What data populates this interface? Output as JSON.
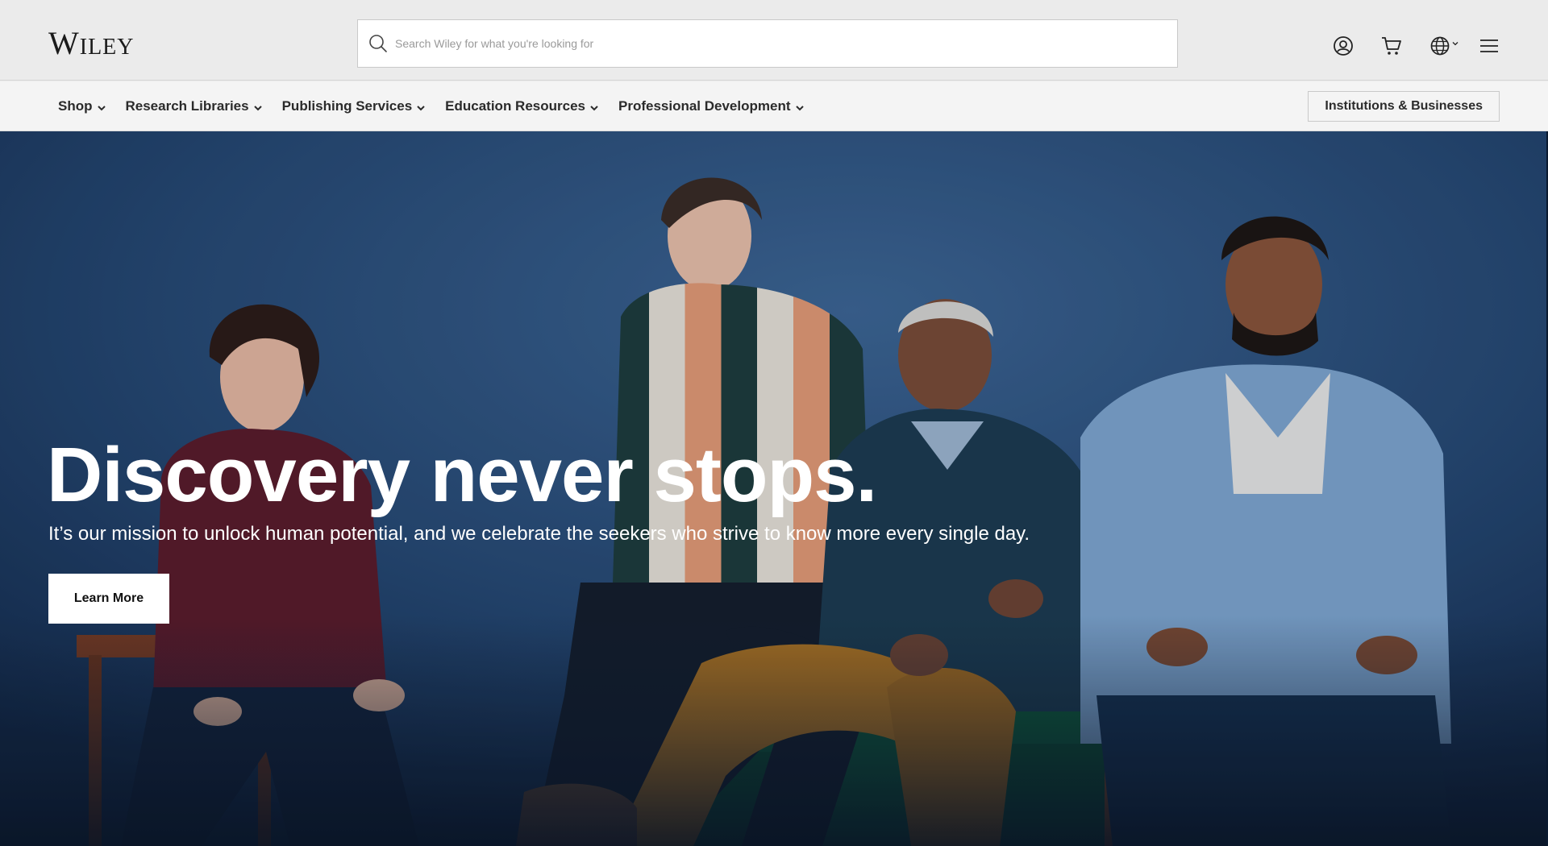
{
  "header": {
    "logo_text": "Wiley",
    "search": {
      "placeholder": "Search Wiley for what you're looking for",
      "value": ""
    },
    "icons": [
      "account-icon",
      "cart-icon",
      "globe-icon",
      "menu-icon"
    ]
  },
  "nav": {
    "items": [
      {
        "label": "Shop"
      },
      {
        "label": "Research Libraries"
      },
      {
        "label": "Publishing Services"
      },
      {
        "label": "Education Resources"
      },
      {
        "label": "Professional Development"
      }
    ],
    "cta_label": "Institutions & Businesses"
  },
  "hero": {
    "title": "Discovery never stops.",
    "subtitle": "It’s our mission to unlock human potential, and we celebrate the seekers who strive to know more every single day.",
    "button_label": "Learn More"
  },
  "colors": {
    "header_bg": "#ebebeb",
    "nav_bg": "#f4f4f4",
    "hero_bg": "#223f63",
    "text_dark": "#2b2b2b",
    "white": "#ffffff"
  }
}
